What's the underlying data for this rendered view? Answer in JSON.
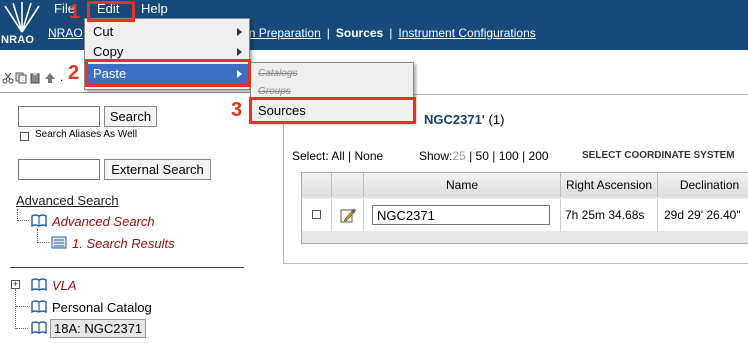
{
  "colors": {
    "header_bg": "#174a7a",
    "accent": "#3b6fc4",
    "annotation": "#e8321e",
    "link_red": "#a01010"
  },
  "header": {
    "logo_text": "NRAO",
    "menu": {
      "file": "File",
      "edit": "Edit",
      "help": "Help"
    },
    "nav": {
      "first": "NRAO",
      "prep": "ion Preparation",
      "sep": "|",
      "sources": "Sources",
      "instrument": "Instrument Configurations"
    }
  },
  "edit_menu": {
    "items": [
      {
        "label": "Cut",
        "has_submenu": true
      },
      {
        "label": "Copy",
        "has_submenu": true
      },
      {
        "label": "Paste",
        "has_submenu": true,
        "selected": true
      }
    ]
  },
  "paste_submenu": {
    "items": [
      {
        "label": "Catalogs",
        "enabled": false
      },
      {
        "label": "Groups",
        "enabled": false
      },
      {
        "label": "Sources",
        "enabled": true
      }
    ]
  },
  "annotations": {
    "one": "1",
    "two": "2",
    "three": "3"
  },
  "left": {
    "search_button": "Search",
    "search_value": "",
    "aliases_label": "Search Aliases As Well",
    "external_button": "External Search",
    "external_value": "",
    "advanced_search_link": "Advanced Search",
    "tree": {
      "advanced_search": "Advanced Search",
      "search_results": "1. Search Results",
      "vla": "VLA",
      "personal": "Personal Catalog",
      "selected": "18A: NGC2371"
    }
  },
  "main": {
    "heading": "NGC2371'",
    "count": "(1)",
    "select_label": "Select:",
    "select_all": "All",
    "select_none": "None",
    "show_label": "Show:",
    "show_25": "25",
    "show_50": "50",
    "show_100": "100",
    "show_200": "200",
    "coord_system": "SELECT COORDINATE SYSTEM",
    "table": {
      "headers": {
        "name": "Name",
        "ra": "Right Ascension",
        "dec": "Declination"
      },
      "rows": [
        {
          "name": "NGC2371",
          "ra": "7h 25m 34.68s",
          "dec": "29d 29' 26.40\""
        }
      ]
    }
  }
}
